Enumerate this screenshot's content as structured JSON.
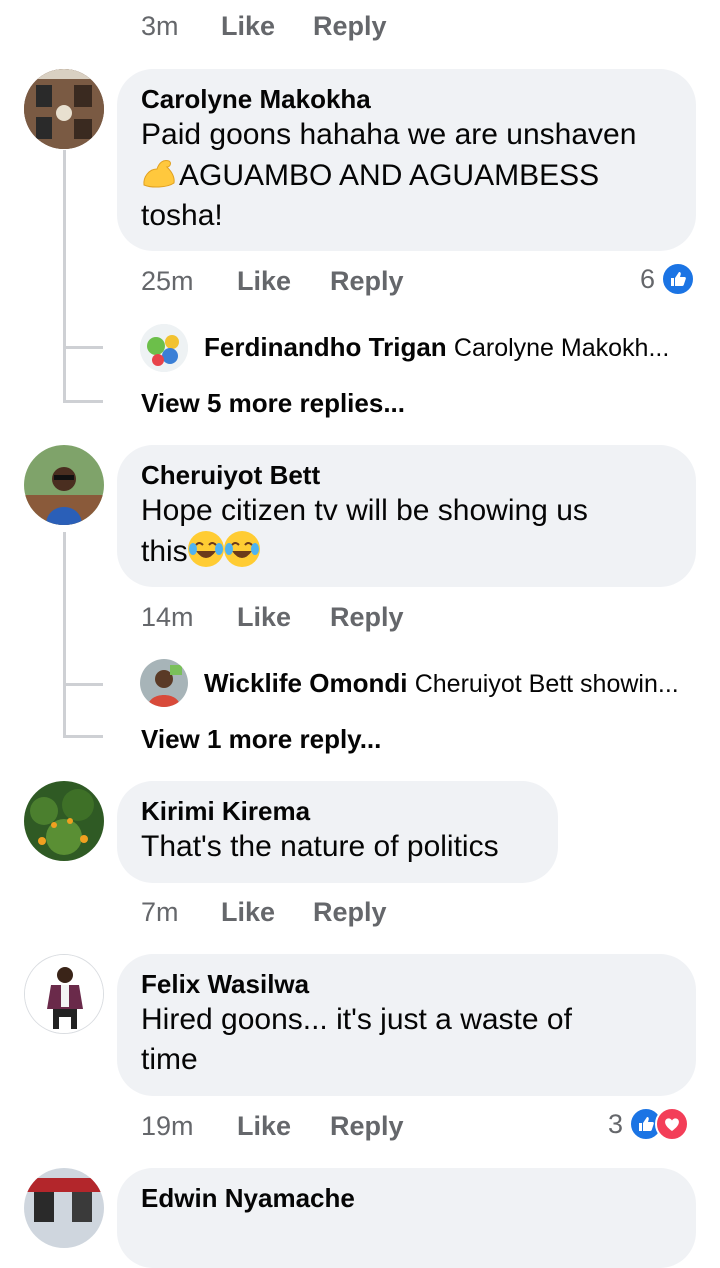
{
  "comments": [
    {
      "time": "3m",
      "like": "Like",
      "reply": "Reply"
    },
    {
      "author": "Carolyne Makokha",
      "text_line1": "Paid goons hahaha we are unshaven",
      "text_line2": "AGUAMBO AND AGUAMBESS",
      "text_line3": "tosha!",
      "emoji": "flexed-biceps",
      "time": "25m",
      "like": "Like",
      "reply": "Reply",
      "reaction_count": "6",
      "reply_preview": {
        "author": "Ferdinandho Trigan",
        "text": "Carolyne Makokh..."
      },
      "view_more": "View 5 more replies..."
    },
    {
      "author": "Cheruiyot Bett",
      "text_line1": "Hope citizen tv will be showing us",
      "text_line2": "this",
      "emoji": "face-with-tears-of-joy",
      "time": "14m",
      "like": "Like",
      "reply": "Reply",
      "reply_preview": {
        "author": "Wicklife Omondi",
        "text": "Cheruiyot Bett showin..."
      },
      "view_more": "View 1 more reply..."
    },
    {
      "author": "Kirimi Kirema",
      "text_line1": "That's the nature of politics",
      "time": "7m",
      "like": "Like",
      "reply": "Reply"
    },
    {
      "author": "Felix Wasilwa",
      "text_line1": "Hired goons... it's just a waste of",
      "text_line2": "time",
      "time": "19m",
      "like": "Like",
      "reply": "Reply",
      "reaction_count": "3"
    },
    {
      "author": "Edwin Nyamache"
    }
  ],
  "colors": {
    "bubble": "#f0f2f5",
    "meta": "#65676b",
    "like_blue": "#1b74e4",
    "love_red": "#f33e58",
    "thread": "#ced0d4"
  }
}
